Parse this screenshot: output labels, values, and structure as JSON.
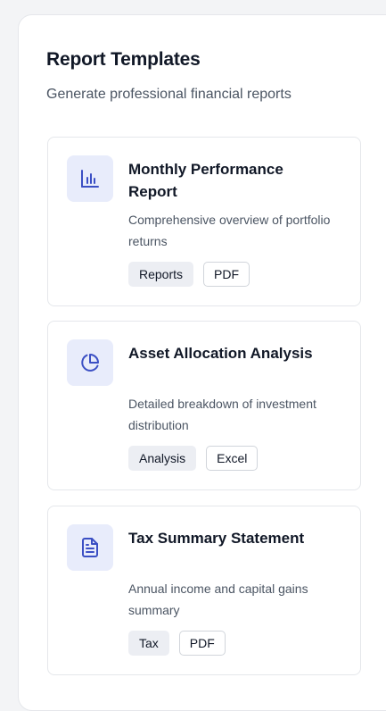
{
  "panel": {
    "title": "Report Templates",
    "subtitle": "Generate professional financial reports"
  },
  "colors": {
    "accent": "#3b4fc4",
    "icon_bg": "#e8ecfb"
  },
  "templates": [
    {
      "icon": "bar-chart-icon",
      "title": "Monthly Performance Report",
      "description": "Comprehensive overview of portfolio returns",
      "category": "Reports",
      "format": "PDF"
    },
    {
      "icon": "pie-chart-icon",
      "title": "Asset Allocation Analysis",
      "description": "Detailed breakdown of investment distribution",
      "category": "Analysis",
      "format": "Excel"
    },
    {
      "icon": "document-icon",
      "title": "Tax Summary Statement",
      "description": "Annual income and capital gains summary",
      "category": "Tax",
      "format": "PDF"
    }
  ]
}
